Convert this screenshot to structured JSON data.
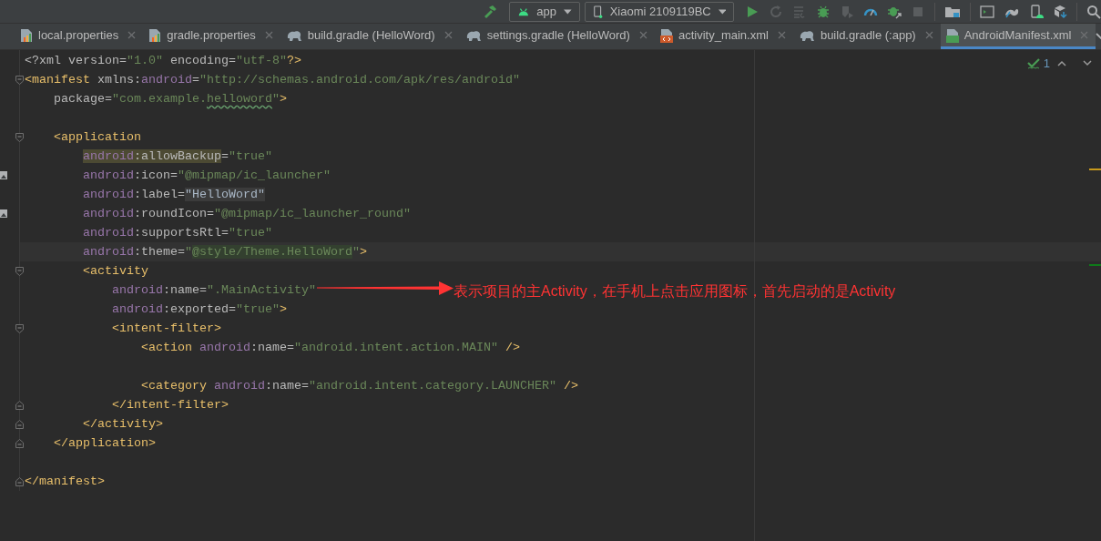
{
  "toolbar": {
    "run_config": "app",
    "device": "Xiaomi 2109119BC"
  },
  "tabs": [
    {
      "label": "local.properties",
      "kind": "properties",
      "selected": false
    },
    {
      "label": "gradle.properties",
      "kind": "properties",
      "selected": false
    },
    {
      "label": "build.gradle (HelloWord)",
      "kind": "gradle",
      "selected": false
    },
    {
      "label": "settings.gradle (HelloWord)",
      "kind": "gradle",
      "selected": false
    },
    {
      "label": "activity_main.xml",
      "kind": "layout",
      "selected": false
    },
    {
      "label": "build.gradle (:app)",
      "kind": "gradle",
      "selected": false
    },
    {
      "label": "AndroidManifest.xml",
      "kind": "manifest",
      "selected": true
    }
  ],
  "inspections": {
    "count": "1"
  },
  "code_lines": [
    {
      "kind": "plain",
      "tokens": [
        {
          "kind": "plain",
          "text": "<?xml version="
        },
        {
          "kind": "value",
          "text": "\"1.0\""
        },
        {
          "kind": "plain",
          "text": " encoding="
        },
        {
          "kind": "value",
          "text": "\"utf-8\""
        },
        {
          "kind": "tag",
          "text": "?>"
        }
      ]
    },
    {
      "kind": "foldstart",
      "tokens": [
        {
          "kind": "tag",
          "text": "<manifest "
        },
        {
          "kind": "attr",
          "text": "xmlns:"
        },
        {
          "kind": "ns",
          "text": "android"
        },
        {
          "kind": "attr",
          "text": "="
        },
        {
          "kind": "value",
          "text": "\"http://schemas.android.com/apk/res/android\""
        }
      ]
    },
    {
      "kind": "plain",
      "tokens": [
        {
          "kind": "attr",
          "text": "    package="
        },
        {
          "kind": "value",
          "text": "\"com.example."
        },
        {
          "kind": "typo",
          "text": "helloword"
        },
        {
          "kind": "value",
          "text": "\""
        },
        {
          "kind": "tag",
          "text": ">"
        }
      ]
    },
    {
      "kind": "plain"
    },
    {
      "kind": "foldstart",
      "tokens": [
        {
          "kind": "tag",
          "text": "    <application"
        }
      ]
    },
    {
      "kind": "plain",
      "tokens": [
        {
          "kind": "nsusage",
          "text": "        android"
        },
        {
          "kind": "attrusage",
          "text": ":allowBackup"
        },
        {
          "kind": "attr",
          "text": "="
        },
        {
          "kind": "value",
          "text": "\"true\""
        }
      ]
    },
    {
      "kind": "image",
      "tokens": [
        {
          "kind": "ns",
          "text": "        android"
        },
        {
          "kind": "attr",
          "text": ":icon="
        },
        {
          "kind": "value",
          "text": "\"@mipmap/ic_launcher\""
        }
      ]
    },
    {
      "kind": "plain",
      "tokens": [
        {
          "kind": "ns",
          "text": "        android"
        },
        {
          "kind": "attr",
          "text": ":label="
        },
        {
          "kind": "folded",
          "text": "\"HelloWord\""
        }
      ]
    },
    {
      "kind": "image",
      "tokens": [
        {
          "kind": "ns",
          "text": "        android"
        },
        {
          "kind": "attr",
          "text": ":roundIcon="
        },
        {
          "kind": "value",
          "text": "\"@mipmap/ic_launcher_round\""
        }
      ]
    },
    {
      "kind": "plain",
      "tokens": [
        {
          "kind": "ns",
          "text": "        android"
        },
        {
          "kind": "attr",
          "text": ":supportsRtl="
        },
        {
          "kind": "value",
          "text": "\"true\""
        }
      ]
    },
    {
      "kind": "current",
      "tokens": [
        {
          "kind": "ns",
          "text": "        android"
        },
        {
          "kind": "attr",
          "text": ":theme="
        },
        {
          "kind": "value",
          "text": "\""
        },
        {
          "kind": "injection",
          "text": "@style/Theme.HelloWord"
        },
        {
          "kind": "value",
          "text": "\""
        },
        {
          "kind": "tag",
          "text": ">"
        }
      ]
    },
    {
      "kind": "foldstart",
      "tokens": [
        {
          "kind": "tag",
          "text": "        <activity"
        }
      ]
    },
    {
      "kind": "plain",
      "tokens": [
        {
          "kind": "ns",
          "text": "            android"
        },
        {
          "kind": "attr",
          "text": ":name="
        },
        {
          "kind": "value",
          "text": "\".MainActivity\""
        }
      ]
    },
    {
      "kind": "plain",
      "tokens": [
        {
          "kind": "ns",
          "text": "            android"
        },
        {
          "kind": "attr",
          "text": ":exported="
        },
        {
          "kind": "value",
          "text": "\"true\""
        },
        {
          "kind": "tag",
          "text": ">"
        }
      ]
    },
    {
      "kind": "foldstart",
      "tokens": [
        {
          "kind": "tag",
          "text": "            <intent-filter>"
        }
      ]
    },
    {
      "kind": "plain",
      "tokens": [
        {
          "kind": "tag",
          "text": "                <action "
        },
        {
          "kind": "ns",
          "text": "android"
        },
        {
          "kind": "attr",
          "text": ":name="
        },
        {
          "kind": "value",
          "text": "\"android.intent.action.MAIN\""
        },
        {
          "kind": "tag",
          "text": " />"
        }
      ]
    },
    {
      "kind": "plain"
    },
    {
      "kind": "plain",
      "tokens": [
        {
          "kind": "tag",
          "text": "                <category "
        },
        {
          "kind": "ns",
          "text": "android"
        },
        {
          "kind": "attr",
          "text": ":name="
        },
        {
          "kind": "value",
          "text": "\"android.intent.category.LAUNCHER\""
        },
        {
          "kind": "tag",
          "text": " />"
        }
      ]
    },
    {
      "kind": "foldend",
      "tokens": [
        {
          "kind": "tag",
          "text": "            </intent-filter>"
        }
      ]
    },
    {
      "kind": "foldend",
      "tokens": [
        {
          "kind": "tag",
          "text": "        </activity>"
        }
      ]
    },
    {
      "kind": "foldend",
      "tokens": [
        {
          "kind": "tag",
          "text": "    </application>"
        }
      ]
    },
    {
      "kind": "plain"
    },
    {
      "kind": "foldend",
      "tokens": [
        {
          "kind": "tag",
          "text": "</manifest>"
        }
      ]
    }
  ],
  "annotation": {
    "text": "表示项目的主Activity，在手机上点击应用图标，首先启动的是Activity",
    "color": "#ff3333"
  }
}
